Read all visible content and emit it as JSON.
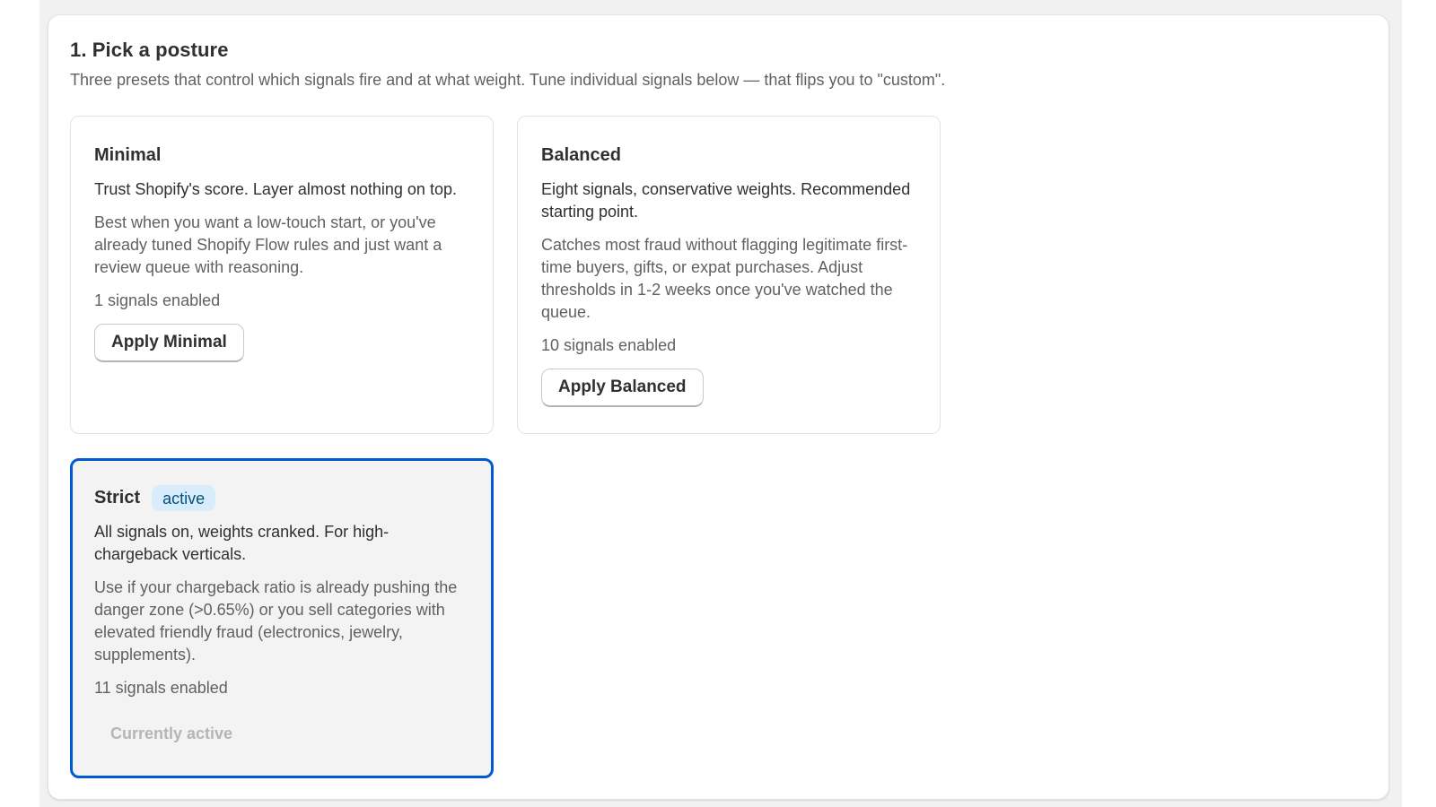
{
  "section": {
    "title": "1. Pick a posture",
    "subtitle": "Three presets that control which signals fire and at what weight. Tune individual signals below — that flips you to \"custom\"."
  },
  "presets": [
    {
      "name": "Minimal",
      "tagline": "Trust Shopify's score. Layer almost nothing on top.",
      "description": "Best when you want a low-touch start, or you've already tuned Shopify Flow rules and just want a review queue with reasoning.",
      "signals": "1 signals enabled",
      "button_label": "Apply Minimal",
      "active": false
    },
    {
      "name": "Balanced",
      "tagline": "Eight signals, conservative weights. Recommended starting point.",
      "description": "Catches most fraud without flagging legitimate first-time buyers, gifts, or expat purchases. Adjust thresholds in 1-2 weeks once you've watched the queue.",
      "signals": "10 signals enabled",
      "button_label": "Apply Balanced",
      "active": false
    },
    {
      "name": "Strict",
      "badge": "active",
      "tagline": "All signals on, weights cranked. For high-chargeback verticals.",
      "description": "Use if your chargeback ratio is already pushing the danger zone (>0.65%) or you sell categories with elevated friendly fraud (electronics, jewelry, supplements).",
      "signals": "11 signals enabled",
      "button_label": "Currently active",
      "active": true
    }
  ],
  "colors": {
    "active_border": "#005bd3",
    "badge_bg": "#d9ecfb",
    "badge_text": "#00527c",
    "page_bg": "#f1f1f1"
  }
}
